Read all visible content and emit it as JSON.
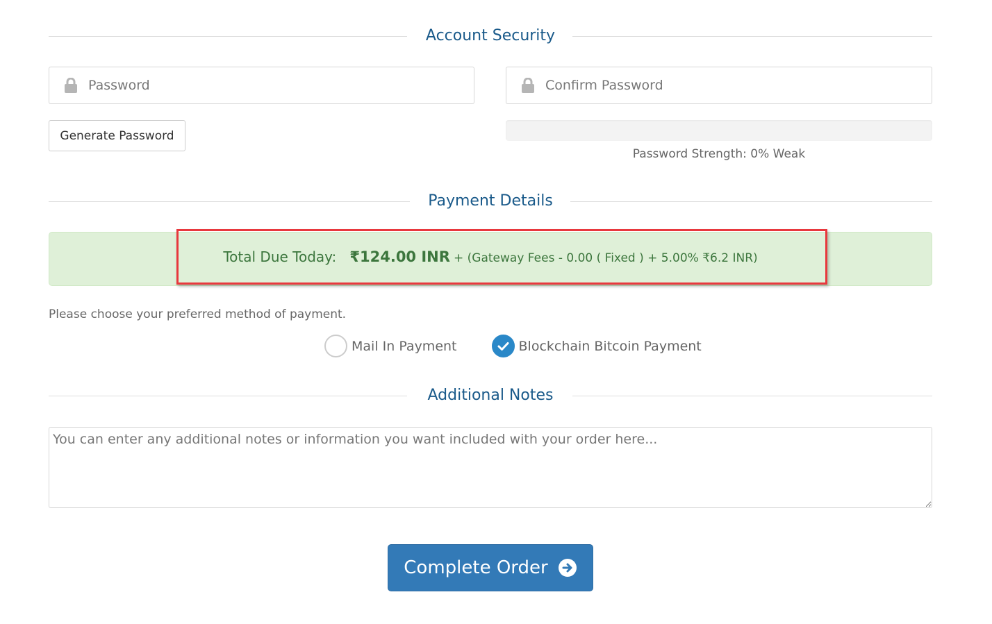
{
  "sections": {
    "account_security": "Account Security",
    "payment_details": "Payment Details",
    "additional_notes": "Additional Notes"
  },
  "password": {
    "placeholder": "Password",
    "value": "",
    "icon": "lock-icon"
  },
  "confirm_password": {
    "placeholder": "Confirm Password",
    "value": "",
    "icon": "lock-icon"
  },
  "generate_password_label": "Generate Password",
  "password_strength": {
    "percent": 0,
    "text": "Password Strength: 0% Weak"
  },
  "payment": {
    "total_label": "Total Due Today:",
    "total_amount": "₹124.00 INR",
    "fees_text": "+ (Gateway Fees - 0.00 ( Fixed ) + 5.00% ₹6.2 INR)",
    "instructions": "Please choose your preferred method of payment.",
    "methods": [
      {
        "label": "Mail In Payment",
        "selected": false
      },
      {
        "label": "Blockchain Bitcoin Payment",
        "selected": true
      }
    ]
  },
  "notes": {
    "placeholder": "You can enter any additional notes or information you want included with your order here...",
    "value": ""
  },
  "complete_order_label": "Complete Order",
  "colors": {
    "heading": "#1a5a8a",
    "primary": "#337ab7",
    "success_bg": "#dff0d8",
    "success_text": "#3c763d",
    "highlight": "#e8383d",
    "radio_checked": "#2a88c8"
  }
}
